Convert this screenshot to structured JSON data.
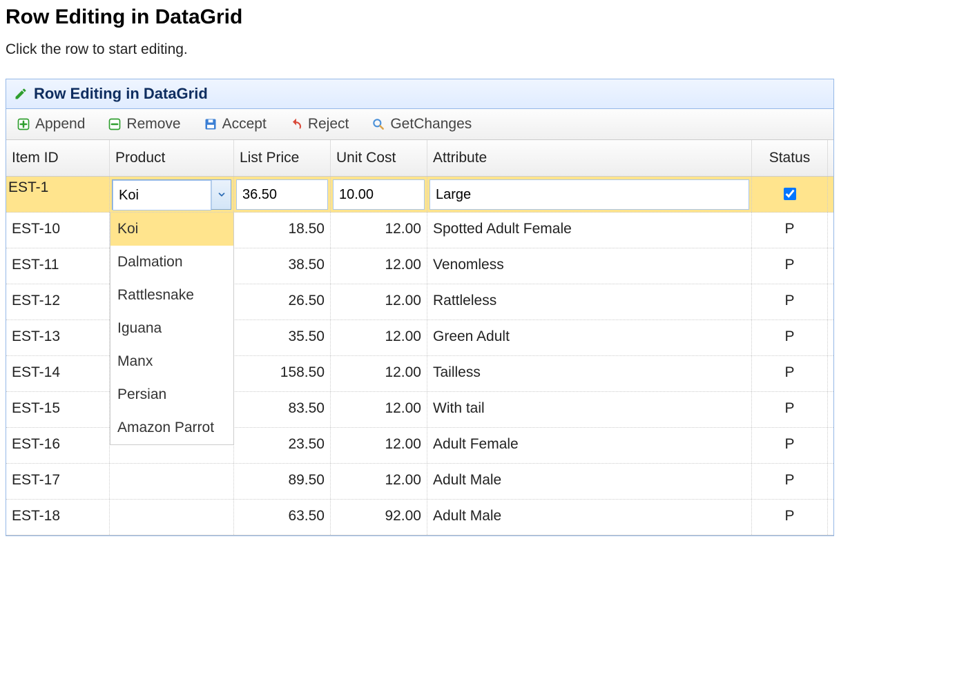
{
  "page": {
    "heading": "Row Editing in DataGrid",
    "instructions": "Click the row to start editing."
  },
  "panel": {
    "title": "Row Editing in DataGrid"
  },
  "toolbar": {
    "append": "Append",
    "remove": "Remove",
    "accept": "Accept",
    "reject": "Reject",
    "getchanges": "GetChanges"
  },
  "columns": {
    "itemid": "Item ID",
    "product": "Product",
    "listprice": "List Price",
    "unitcost": "Unit Cost",
    "attribute": "Attribute",
    "status": "Status"
  },
  "editingRow": {
    "itemid": "EST-1",
    "product": "Koi",
    "listprice": "36.50",
    "unitcost": "10.00",
    "attribute": "Large",
    "status_checked": true
  },
  "rows": [
    {
      "itemid": "EST-10",
      "product": "",
      "listprice": "18.50",
      "unitcost": "12.00",
      "attribute": "Spotted Adult Female",
      "status": "P"
    },
    {
      "itemid": "EST-11",
      "product": "",
      "listprice": "38.50",
      "unitcost": "12.00",
      "attribute": "Venomless",
      "status": "P"
    },
    {
      "itemid": "EST-12",
      "product": "",
      "listprice": "26.50",
      "unitcost": "12.00",
      "attribute": "Rattleless",
      "status": "P"
    },
    {
      "itemid": "EST-13",
      "product": "",
      "listprice": "35.50",
      "unitcost": "12.00",
      "attribute": "Green Adult",
      "status": "P"
    },
    {
      "itemid": "EST-14",
      "product": "",
      "listprice": "158.50",
      "unitcost": "12.00",
      "attribute": "Tailless",
      "status": "P"
    },
    {
      "itemid": "EST-15",
      "product": "",
      "listprice": "83.50",
      "unitcost": "12.00",
      "attribute": "With tail",
      "status": "P"
    },
    {
      "itemid": "EST-16",
      "product": "",
      "listprice": "23.50",
      "unitcost": "12.00",
      "attribute": "Adult Female",
      "status": "P"
    },
    {
      "itemid": "EST-17",
      "product": "",
      "listprice": "89.50",
      "unitcost": "12.00",
      "attribute": "Adult Male",
      "status": "P"
    },
    {
      "itemid": "EST-18",
      "product": "",
      "listprice": "63.50",
      "unitcost": "92.00",
      "attribute": "Adult Male",
      "status": "P"
    }
  ],
  "dropdown": {
    "selected": "Koi",
    "options": [
      "Koi",
      "Dalmation",
      "Rattlesnake",
      "Iguana",
      "Manx",
      "Persian",
      "Amazon Parrot"
    ]
  }
}
